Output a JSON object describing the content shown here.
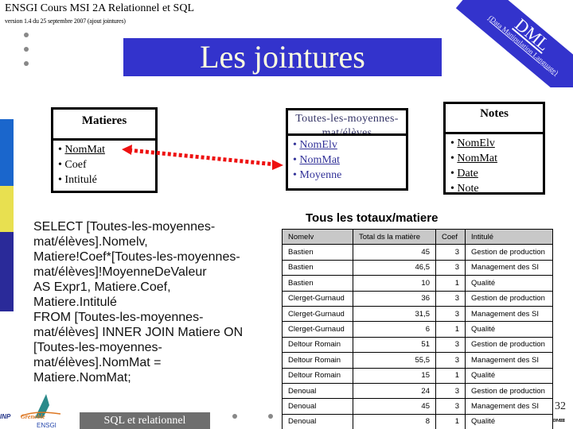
{
  "header": {
    "course_title": "ENSGI Cours MSI 2A Relationnel et SQL",
    "version": "version 1.4  du 25 septembre 2007 (ajout jointures)"
  },
  "slide": {
    "title": "Les jointures",
    "ribbon": {
      "label": "DML",
      "sublabel": "(Data Manipulation Language)"
    }
  },
  "diagram": {
    "matieres": {
      "name": "Matieres",
      "fields": [
        {
          "label": "NomMat",
          "key": true
        },
        {
          "label": "Coef",
          "key": false
        },
        {
          "label": "Intitulé",
          "key": false
        }
      ]
    },
    "moyennes": {
      "name": "Toutes-les-moyennes-mat/élèves",
      "fields": [
        {
          "label": "NomElv",
          "key": true
        },
        {
          "label": "NomMat",
          "key": true
        },
        {
          "label": "Moyenne",
          "key": false
        }
      ]
    },
    "notes": {
      "name": "Notes",
      "fields": [
        {
          "label": "NomElv",
          "key": true
        },
        {
          "label": "NomMat",
          "key": true
        },
        {
          "label": "Date",
          "key": true
        },
        {
          "label": "Note",
          "key": false
        }
      ]
    },
    "join_color": "#ee1111"
  },
  "sql": {
    "lines": [
      "SELECT [Toutes-les-moyennes-",
      "mat/élèves].Nomelv,",
      "Matiere!Coef*[Toutes-les-moyennes-",
      "mat/élèves]!MoyenneDeValeur",
      "AS Expr1, Matiere.Coef,",
      "Matiere.Intitulé",
      "FROM [Toutes-les-moyennes-",
      "mat/élèves] INNER JOIN Matiere ON",
      "[Toutes-les-moyennes-",
      "mat/élèves].NomMat =",
      "Matiere.NomMat;"
    ]
  },
  "results": {
    "title": "Tous les totaux/matiere",
    "columns": [
      "Nomelv",
      "Total ds la matière",
      "Coef",
      "Intitulé"
    ],
    "rows": [
      [
        "Bastien",
        "45",
        "3",
        "Gestion de production"
      ],
      [
        "Bastien",
        "46,5",
        "3",
        "Management des SI"
      ],
      [
        "Bastien",
        "10",
        "1",
        "Qualité"
      ],
      [
        "Clerget-Gurnaud",
        "36",
        "3",
        "Gestion de production"
      ],
      [
        "Clerget-Gurnaud",
        "31,5",
        "3",
        "Management des SI"
      ],
      [
        "Clerget-Gurnaud",
        "6",
        "1",
        "Qualité"
      ],
      [
        "Deltour Romain",
        "51",
        "3",
        "Gestion de production"
      ],
      [
        "Deltour Romain",
        "55,5",
        "3",
        "Management des SI"
      ],
      [
        "Deltour Romain",
        "15",
        "1",
        "Qualité"
      ],
      [
        "Denoual",
        "24",
        "3",
        "Gestion de production"
      ],
      [
        "Denoual",
        "45",
        "3",
        "Management des SI"
      ],
      [
        "Denoual",
        "8",
        "1",
        "Qualité"
      ]
    ]
  },
  "footer": {
    "logo": {
      "inp": "INP",
      "grenoble": "Grenoble",
      "school": "ENSGI"
    },
    "tag": "SQL et relationnel",
    "page_number": "32",
    "page_mark": "DMIII"
  },
  "colors": {
    "banner": "#3333cc",
    "banner_text": "#ffffe0",
    "side_blue": "#1a66cc",
    "side_yellow": "#e8e050",
    "side_navy": "#2a2a99",
    "footer_tag": "#6e6e6e",
    "table_header": "#c8c8c8"
  }
}
